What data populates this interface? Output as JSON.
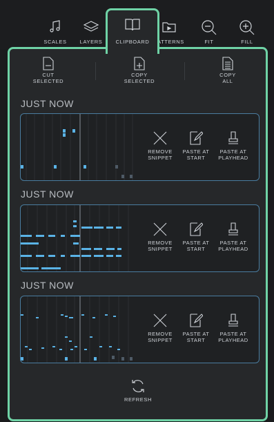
{
  "toolbar": {
    "tabs": [
      {
        "label": "SCALES",
        "icon": "music-note-icon"
      },
      {
        "label": "LAYERS",
        "icon": "layers-icon"
      },
      {
        "label": "CLIPBOARD",
        "icon": "clipboard-book-icon",
        "active": true
      },
      {
        "label": "PATTERNS",
        "icon": "patterns-folder-icon"
      },
      {
        "label": "FIT",
        "icon": "zoom-out-icon"
      },
      {
        "label": "FILL",
        "icon": "zoom-in-icon"
      }
    ]
  },
  "actions": {
    "cut": {
      "line1": "CUT",
      "line2": "SELECTED"
    },
    "copy_selected": {
      "line1": "COPY",
      "line2": "SELECTED"
    },
    "copy_all": {
      "line1": "COPY",
      "line2": "ALL"
    }
  },
  "snippets": [
    {
      "title": "JUST NOW"
    },
    {
      "title": "JUST NOW"
    },
    {
      "title": "JUST NOW"
    }
  ],
  "snippet_buttons": {
    "remove": {
      "line1": "REMOVE",
      "line2": "SNIPPET"
    },
    "paste_start": {
      "line1": "PASTE AT",
      "line2": "START"
    },
    "paste_playhead": {
      "line1": "PASTE AT",
      "line2": "PLAYHEAD"
    }
  },
  "refresh": {
    "label": "REFRESH"
  },
  "colors": {
    "accent": "#6fd3a6",
    "note": "#5ab3e6",
    "note_dim": "#4e5a66",
    "snippet_border": "#4a7da0"
  }
}
